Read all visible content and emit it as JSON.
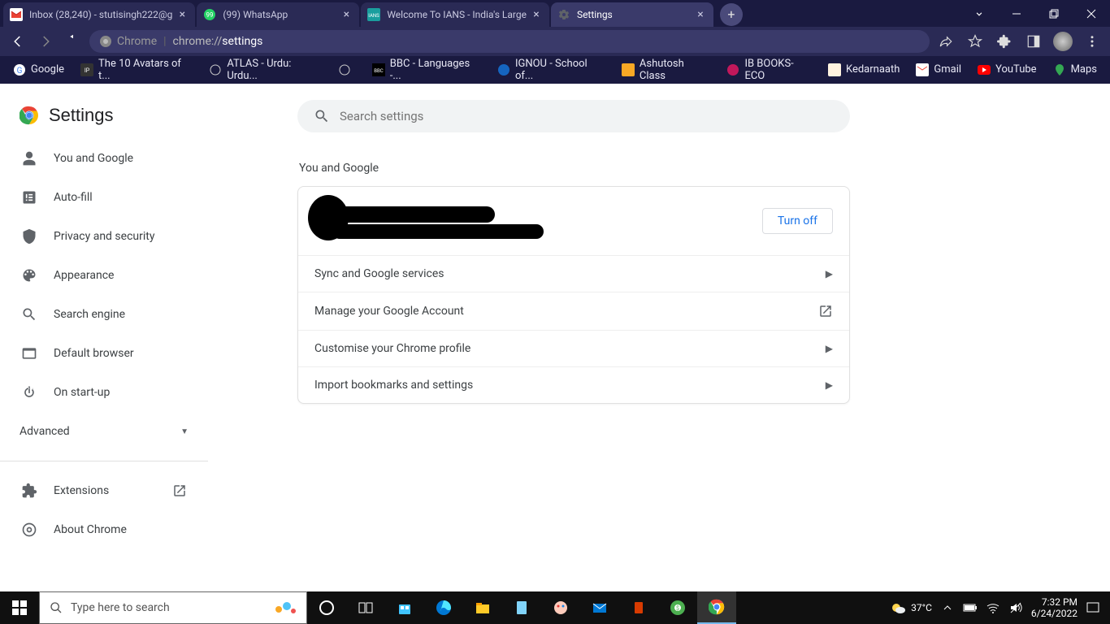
{
  "tabs": [
    {
      "title": "Inbox (28,240) - stutisingh222@g"
    },
    {
      "title": "(99) WhatsApp"
    },
    {
      "title": "Welcome To IANS - India's Large"
    },
    {
      "title": "Settings"
    }
  ],
  "toolbar": {
    "secure_label": "Chrome",
    "url_prefix": "chrome://",
    "url_path": "settings"
  },
  "bookmarks": [
    {
      "label": "Google"
    },
    {
      "label": "The 10 Avatars of t..."
    },
    {
      "label": "ATLAS - Urdu: Urdu..."
    },
    {
      "label": ""
    },
    {
      "label": "BBC - Languages -..."
    },
    {
      "label": "IGNOU - School of..."
    },
    {
      "label": "Ashutosh Class"
    },
    {
      "label": "IB BOOKS-ECO"
    },
    {
      "label": "Kedarnaath"
    },
    {
      "label": "Gmail"
    },
    {
      "label": "YouTube"
    },
    {
      "label": "Maps"
    }
  ],
  "settings": {
    "brand": "Settings",
    "search_placeholder": "Search settings",
    "nav": {
      "you": "You and Google",
      "autofill": "Auto-fill",
      "privacy": "Privacy and security",
      "appearance": "Appearance",
      "search": "Search engine",
      "default_browser": "Default browser",
      "startup": "On start-up",
      "advanced": "Advanced",
      "extensions": "Extensions",
      "about": "About Chrome"
    },
    "section_title": "You and Google",
    "turnoff": "Turn off",
    "rows": {
      "sync": "Sync and Google services",
      "manage": "Manage your Google Account",
      "customise": "Customise your Chrome profile",
      "import": "Import bookmarks and settings"
    }
  },
  "taskbar": {
    "search_placeholder": "Type here to search",
    "weather": "37°C",
    "time": "7:32 PM",
    "date": "6/24/2022"
  }
}
